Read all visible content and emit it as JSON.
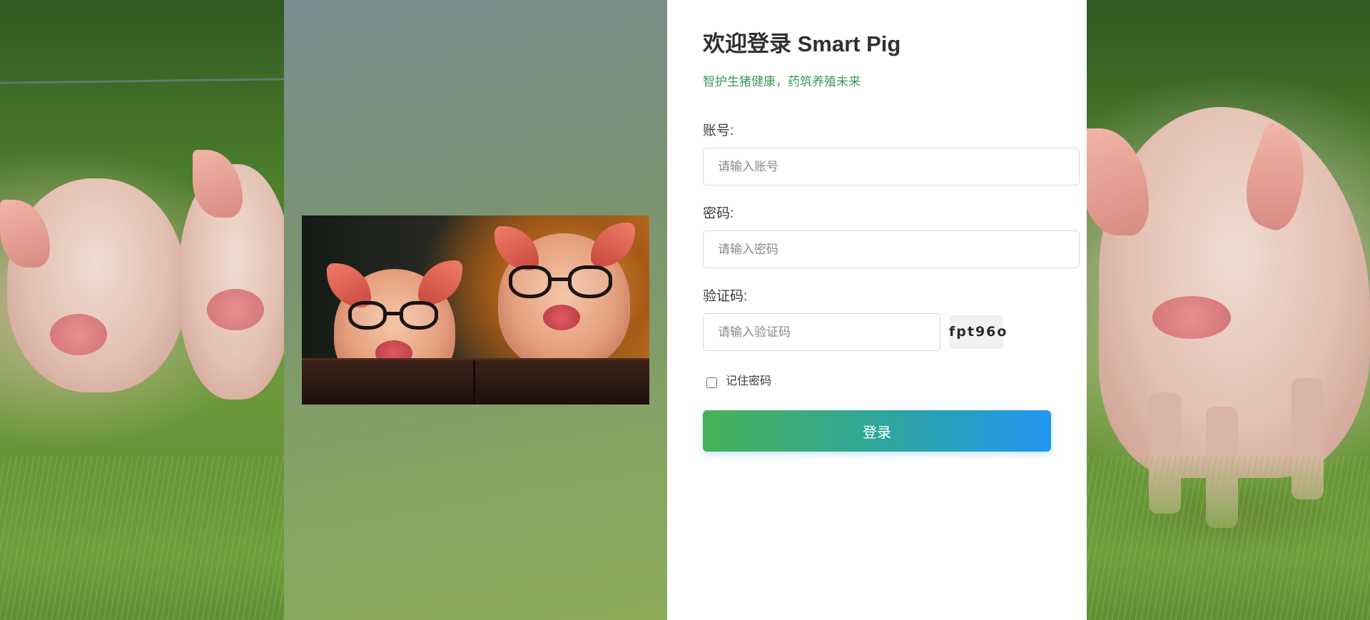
{
  "login": {
    "title": "欢迎登录 Smart Pig",
    "subtitle": "智护生猪健康，药筑养殖未来",
    "account_label": "账号:",
    "account_placeholder": "请输入账号",
    "password_label": "密码:",
    "password_placeholder": "请输入密码",
    "captcha_label": "验证码:",
    "captcha_placeholder": "请输入验证码",
    "captcha_code": "fpt96o",
    "remember_label": "记住密码",
    "remember_checked": false,
    "login_button": "登录"
  },
  "colors": {
    "subtitle": "#3a9a5a",
    "button_gradient_start": "#47b257",
    "button_gradient_end": "#2296f2"
  }
}
